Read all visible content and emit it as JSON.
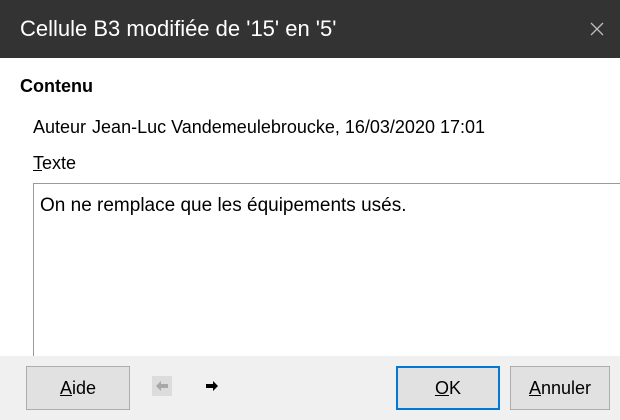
{
  "window": {
    "title": "Cellule B3 modifiée de '15' en '5'"
  },
  "content": {
    "section_title": "Contenu",
    "author_label": "Auteur",
    "author_value": "Jean-Luc Vandemeulebroucke, 16/03/2020 17:01",
    "text_label_mnemonic": "T",
    "text_label_rest": "exte",
    "text_value": "On ne remplace que les équipements usés."
  },
  "footer": {
    "help_mnemonic": "A",
    "help_rest": "ide",
    "ok_mnemonic": "O",
    "ok_rest": "K",
    "cancel_mnemonic": "A",
    "cancel_rest": "nnuler"
  }
}
